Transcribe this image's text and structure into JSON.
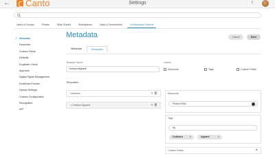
{
  "app": {
    "back_icon": "back-arrow-icon",
    "logo_text": "Canto",
    "title": "Settings",
    "alert_mark": "!"
  },
  "search": {
    "placeholder": "",
    "icon": "search-icon"
  },
  "tabs": [
    {
      "label": "Users & Groups",
      "active": false
    },
    {
      "label": "Portals",
      "active": false
    },
    {
      "label": "Style Guides",
      "active": false
    },
    {
      "label": "Workspaces",
      "active": false
    },
    {
      "label": "Links & Connections",
      "active": false
    },
    {
      "label": "Configuration Options",
      "active": true
    }
  ],
  "sidebar": {
    "items": [
      {
        "label": "Metadata",
        "active": true
      },
      {
        "label": "Keywords",
        "active": false
      },
      {
        "label": "Custom Fields",
        "active": false
      },
      {
        "label": "Defaults",
        "active": false
      },
      {
        "label": "Duplicate Check",
        "active": false
      },
      {
        "label": "Approval",
        "active": false
      },
      {
        "label": "Digital Rights Management",
        "active": false
      },
      {
        "label": "Download Presets",
        "active": false
      },
      {
        "label": "Upload Settings",
        "active": false
      },
      {
        "label": "Custom Configuration",
        "active": false
      },
      {
        "label": "Recognition",
        "active": false
      },
      {
        "label": "API",
        "active": false
      }
    ]
  },
  "main": {
    "title": "Metadata",
    "cancel_label": "Cancel",
    "save_label": "Save",
    "subtabs": [
      {
        "label": "Metadata",
        "active": false
      },
      {
        "label": "Templates",
        "active": true
      }
    ],
    "template_name_label": "Template Name*",
    "template_name_value": "Outdoor Apparel",
    "include_label": "Include",
    "include_options": [
      {
        "label": "Keywords",
        "checked": false
      },
      {
        "label": "Tags",
        "checked": false
      },
      {
        "label": "Custom Fields",
        "checked": false
      }
    ],
    "templates_label": "Templates",
    "templates": [
      {
        "label": "Outdoors",
        "selected": false
      },
      {
        "label": "> Outdoor Apparel",
        "selected": true
      }
    ],
    "keywords_panel": {
      "title": "Keywords",
      "value": "Product Shot"
    },
    "tags_panel": {
      "title": "Tags",
      "input_value": "Hi|",
      "chips": [
        "Outdoors",
        "Apparel"
      ]
    },
    "custom_fields_panel": {
      "title": "Custom Fields",
      "add_symbol": "+"
    }
  }
}
